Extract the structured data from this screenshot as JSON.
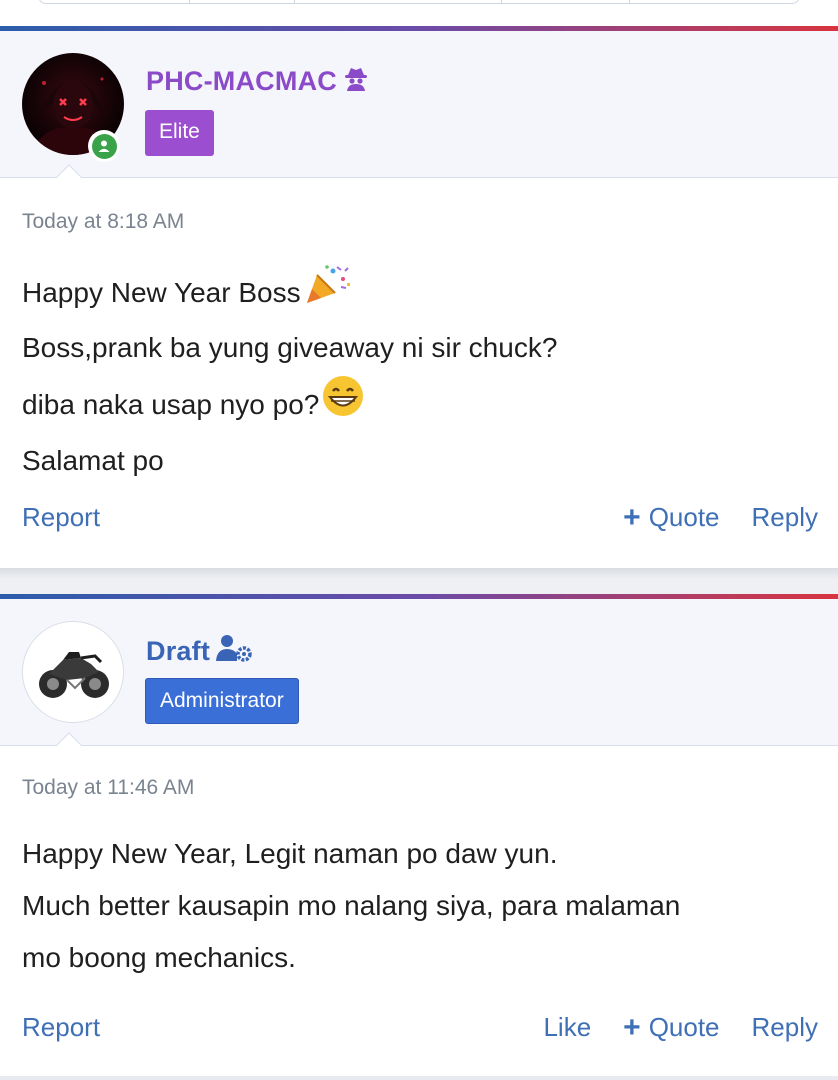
{
  "posts": [
    {
      "username": "PHC-MACMAC",
      "user_icon": "spy-icon",
      "user_color": "#8b4bc8",
      "badge": "Elite",
      "badge_color": "#9b4fd0",
      "online": true,
      "timestamp": "Today at 8:18 AM",
      "lines": [
        "Happy New Year Boss",
        "Boss,prank ba yung giveaway ni sir chuck?",
        "diba naka usap nyo po?",
        "Salamat po"
      ],
      "actions": {
        "report": "Report",
        "quote": "Quote",
        "reply": "Reply"
      }
    },
    {
      "username": "Draft",
      "user_icon": "user-cog-icon",
      "user_color": "#3a64b5",
      "badge": "Administrator",
      "badge_color": "#3a6fd8",
      "timestamp": "Today at 11:46 AM",
      "lines": [
        "Happy New Year, Legit naman po daw yun.",
        "Much better kausapin mo nalang siya, para malaman",
        "mo boong mechanics."
      ],
      "actions": {
        "report": "Report",
        "like": "Like",
        "quote": "Quote",
        "reply": "Reply"
      }
    }
  ]
}
